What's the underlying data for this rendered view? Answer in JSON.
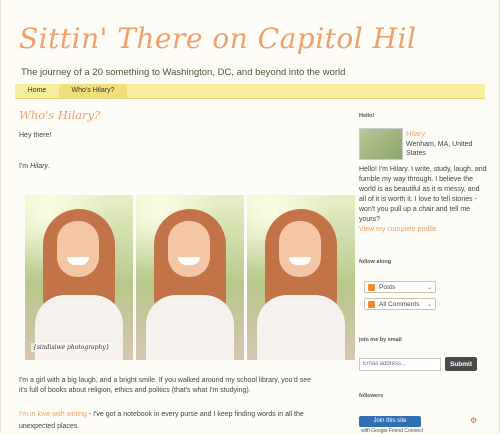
{
  "blog": {
    "title": "Sittin' There on Capitol Hil",
    "tagline": "The journey of a 20 something to Washington, DC, and beyond into the world"
  },
  "nav": {
    "tabs": [
      {
        "label": "Home"
      },
      {
        "label": "Who's Hilary?"
      }
    ]
  },
  "post": {
    "title": "Who's Hilary?",
    "greeting": "Hey there!",
    "intro_prefix": "I'm ",
    "intro_name": "Hilary",
    "intro_suffix": ".",
    "photo_credit": "{sindisiwe photography}",
    "paragraph1_line1": "I'm a girl with a big laugh, and a bright smile. If you walked around my school library, you'd see",
    "paragraph1_line2": "it's full of books about religion, ethics and politics (that's what I'm studying).",
    "paragraph2_link": "I'm in love with writing",
    "paragraph2_line1": " - I've got a notebook in every purse and I keep finding words in all the",
    "paragraph2_line2": "unexpected places."
  },
  "sidebar": {
    "hello_heading": "Hello!",
    "profile": {
      "name": "Hilary",
      "location": "Wenham, MA, United States",
      "bio": "Hello! I'm Hilary. I write, study, laugh, and fumble my way through. I believe the world is as beautiful as it is messy, and all of it is worth it. I love to tell stories - won't you pull up a chair and tell me yours?",
      "link": "View my complete profile"
    },
    "follow_heading": "follow along",
    "follow": {
      "posts_label": "Posts",
      "comments_label": "All Comments",
      "chevron": "⌄"
    },
    "email_heading": "join me by email",
    "email": {
      "placeholder": "Email address...",
      "submit_label": "Submit"
    },
    "followers_heading": "followers",
    "followers": {
      "join_label": "Join this site",
      "caption": "with Google Friend Connect"
    }
  }
}
